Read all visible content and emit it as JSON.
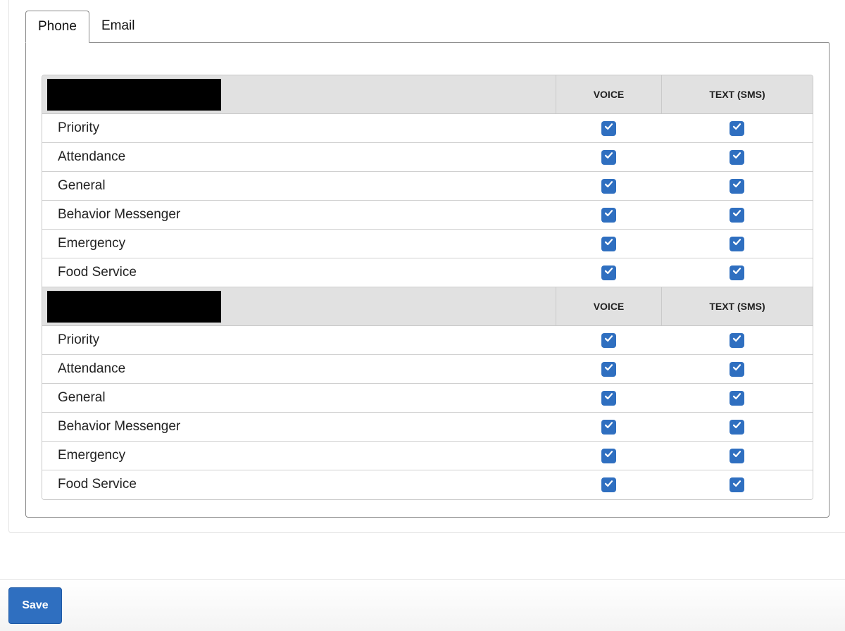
{
  "tabs": [
    {
      "label": "Phone",
      "active": true
    },
    {
      "label": "Email",
      "active": false
    }
  ],
  "columns": {
    "voice": "VOICE",
    "text": "TEXT (SMS)"
  },
  "groups": [
    {
      "rows": [
        {
          "label": "Priority",
          "voice": true,
          "text": true
        },
        {
          "label": "Attendance",
          "voice": true,
          "text": true
        },
        {
          "label": "General",
          "voice": true,
          "text": true
        },
        {
          "label": "Behavior Messenger",
          "voice": true,
          "text": true
        },
        {
          "label": "Emergency",
          "voice": true,
          "text": true
        },
        {
          "label": "Food Service",
          "voice": true,
          "text": true
        }
      ]
    },
    {
      "rows": [
        {
          "label": "Priority",
          "voice": true,
          "text": true
        },
        {
          "label": "Attendance",
          "voice": true,
          "text": true
        },
        {
          "label": "General",
          "voice": true,
          "text": true
        },
        {
          "label": "Behavior Messenger",
          "voice": true,
          "text": true
        },
        {
          "label": "Emergency",
          "voice": true,
          "text": true
        },
        {
          "label": "Food Service",
          "voice": true,
          "text": true
        }
      ]
    }
  ],
  "actions": {
    "save_label": "Save"
  },
  "colors": {
    "accent": "#2f6fc0",
    "header_bg": "#e1e1e1"
  }
}
